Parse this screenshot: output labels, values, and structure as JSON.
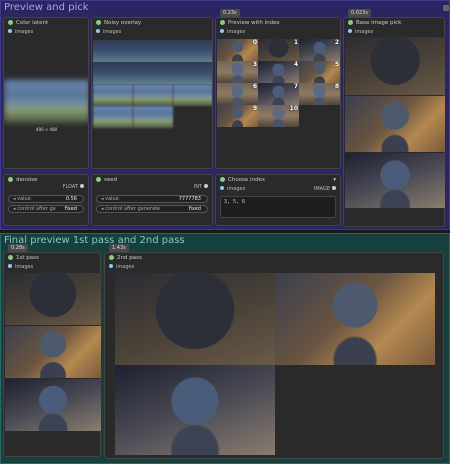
{
  "groups": {
    "preview": "Preview and pick",
    "final": "Final preview 1st pass and 2nd pass"
  },
  "nodes": {
    "color_latent": {
      "title": "Color latent",
      "slot": "images",
      "caption": "400 × 480"
    },
    "noisy_overlay": {
      "title": "Noisy overlay",
      "slot": "images"
    },
    "preview_index": {
      "title": "Preview with index",
      "slot": "images",
      "badge": "0.23s",
      "indices": [
        "0",
        "1",
        "2",
        "3",
        "4",
        "5",
        "6",
        "7",
        "8",
        "9",
        "10"
      ]
    },
    "base_pick": {
      "title": "Base image pick",
      "slot": "images",
      "badge": "0.023s"
    },
    "denoise": {
      "title": "denoise",
      "out": "FLOAT",
      "w1_label": "value",
      "w1_val": "0.56",
      "w2_label": "control after ge",
      "w2_val": "fixed"
    },
    "seed": {
      "title": "seed",
      "out": "INT",
      "w1_label": "value",
      "w1_val": "7777783",
      "w2_label": "control after generate",
      "w2_val": "fixed"
    },
    "choose_index": {
      "title": "Choose index",
      "slot": "images",
      "out": "IMAGE",
      "text": "3, 5, 6"
    },
    "first_pass": {
      "title": "1st pass",
      "slot": "images",
      "badge": "0.28s"
    },
    "second_pass": {
      "title": "2nd pass",
      "slot": "images",
      "badge": "1.43s"
    }
  },
  "colors": {
    "group_purple": "#2b2561",
    "group_teal": "#15403d",
    "header_purple": "#3b3a8c",
    "header_teal": "#1f6e67"
  }
}
